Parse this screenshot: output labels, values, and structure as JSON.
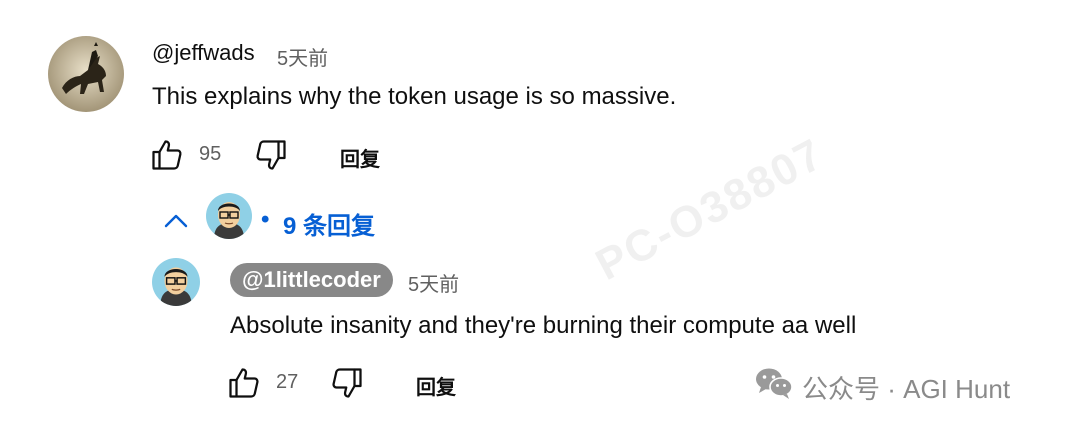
{
  "comment": {
    "handle": "@jeffwads",
    "time": "5天前",
    "text": "This explains why the token usage is so massive.",
    "likes": "95",
    "reply_label": "回复"
  },
  "replies_toggle": {
    "bullet": "•",
    "label": "9 条回复"
  },
  "reply": {
    "handle": "@1littlecoder",
    "time": "5天前",
    "text": "Absolute insanity and they're burning their compute aa well",
    "likes": "27",
    "reply_label": "回复"
  },
  "watermark": {
    "diagonal": "PC-O38807",
    "source": "公众号 · AGI Hunt"
  },
  "colors": {
    "link_blue": "#065fd4",
    "secondary_text": "#606060",
    "badge_bg": "#888888"
  },
  "icons": [
    "thumbs-up-icon",
    "thumbs-down-icon",
    "chevron-up-icon",
    "wechat-icon"
  ]
}
